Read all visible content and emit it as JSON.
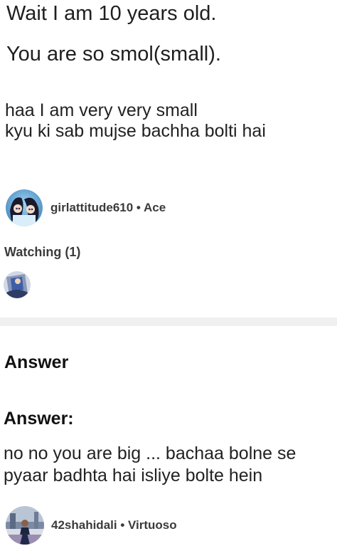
{
  "question": {
    "lines": [
      "Wait I am 10 years old.",
      "You are so smol(small)."
    ],
    "detail": "haa I am very very small\nkyu ki sab mujse bachha bolti hai"
  },
  "asker": {
    "name_rank": "girlattitude610 • Ace",
    "avatar_icon": "anime-avatar-icon"
  },
  "watching": {
    "label": "Watching (1)",
    "avatar_icon": "watcher-avatar-icon"
  },
  "answer_section": {
    "heading": "Answer",
    "subheading": "Answer:",
    "text": "no no you are big ... bachaa bolne se\npyaar badhta hai isliye bolte hein"
  },
  "answerer": {
    "name_rank": "42shahidali • Virtuoso",
    "avatar_icon": "photo-avatar-icon"
  },
  "colors": {
    "text": "#1f1f1f",
    "meta": "#3b3b3b",
    "divider": "#f0f0f0"
  }
}
